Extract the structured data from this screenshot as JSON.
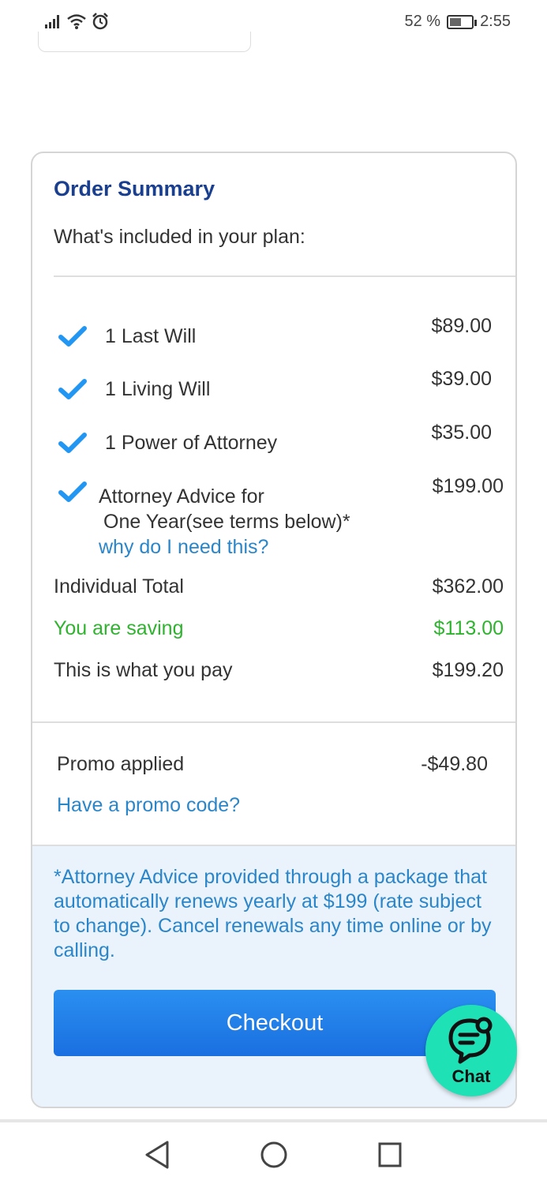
{
  "status_bar": {
    "battery_percent": "52 %",
    "time": "2:55",
    "battery_level": 0.52,
    "icons": [
      "signal-icon",
      "wifi-icon",
      "alarm-icon",
      "battery-icon"
    ]
  },
  "order_summary": {
    "title": "Order Summary",
    "subtitle": "What's included in your plan:",
    "items": [
      {
        "label": "1 Last Will",
        "price": "$89.00"
      },
      {
        "label": "1 Living Will",
        "price": "$39.00"
      },
      {
        "label": "1 Power of Attorney",
        "price": "$35.00"
      },
      {
        "label_line1": "Attorney Advice for",
        "label_line2": "One Year(see terms below)*",
        "link": "why do I need this?",
        "price": "$199.00"
      }
    ],
    "individual_total_label": "Individual Total",
    "individual_total_value": "$362.00",
    "saving_label": "You are saving",
    "saving_value": "$113.00",
    "pay_label": "This is what you pay",
    "pay_value": "$199.20",
    "promo_label": "Promo applied",
    "promo_value": "-$49.80",
    "promo_link": "Have a promo code?",
    "disclaimer": "*Attorney Advice provided through a package that automatically renews yearly at $199 (rate subject to change). Cancel renewals any time online or by calling.",
    "checkout_label": "Checkout"
  },
  "chat": {
    "label": "Chat",
    "icon": "chat-bubble-icon"
  },
  "colors": {
    "title": "#1b3f8f",
    "link": "#2b86c9",
    "saving": "#2fb32f",
    "checkout": "#1a6fe0",
    "chat_bg": "#1ee2b6",
    "check": "#2196f3",
    "disclaimer_bg": "#eaf2fb"
  },
  "nav_bar": {
    "icons": [
      "back-triangle-icon",
      "home-circle-icon",
      "recents-square-icon"
    ]
  }
}
